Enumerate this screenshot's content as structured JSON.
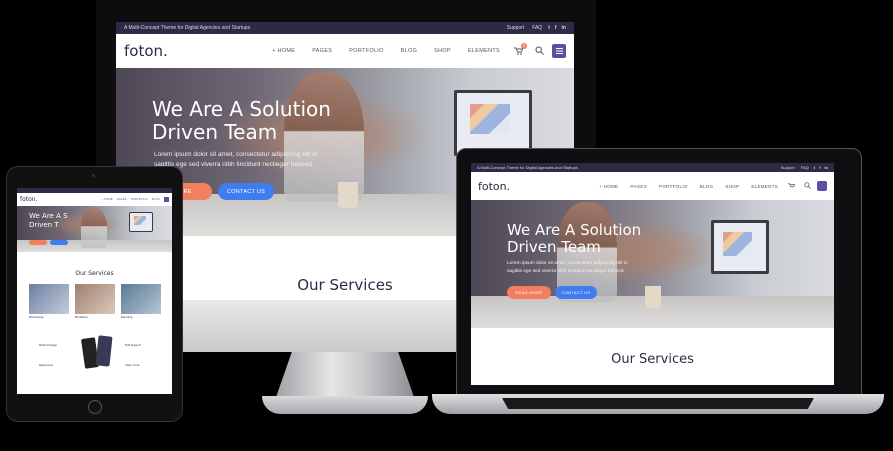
{
  "site": {
    "tagline": "A Multi-Concept Theme for Digital Agencies and Startups",
    "topbar_links": [
      "Support",
      "FAQ"
    ],
    "social_icons": [
      "twitter-icon",
      "facebook-icon",
      "linkedin-icon"
    ],
    "logo": "foton.",
    "menu": [
      "+ HOME",
      "PAGES",
      "PORTFOLIO",
      "BLOG",
      "SHOP",
      "ELEMENTS"
    ],
    "cart_count": "0",
    "hero": {
      "title_line1": "We Are A Solution",
      "title_line2": "Driven Team",
      "text_line1": "Lorem ipsum dolor sit amet, consectetur adipiscing elit in",
      "text_line2": "sagittis ege sed viverra nibh tincidunt neclieger hensed.",
      "btn_primary": "MORE",
      "btn_primary_laptop": "READ MORE",
      "btn_secondary": "CONTACT US"
    },
    "services_title": "Our Services"
  },
  "tablet": {
    "hero_title_line1": "We Are A S",
    "hero_title_line2": "Driven T",
    "services_title": "Our Services",
    "service_cards": [
      "Web Design",
      "Marketing",
      "Branding"
    ],
    "features": [
      "Perfect Design",
      "Fast Support",
      "Responsive",
      "Clean Code"
    ]
  },
  "colors": {
    "accent_navy": "#2c2a45",
    "accent_orange": "#f27f5e",
    "accent_blue": "#3f7cf0",
    "menu_button": "#5b4fa0"
  }
}
